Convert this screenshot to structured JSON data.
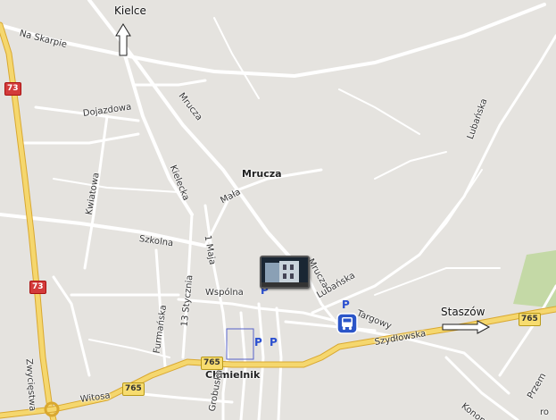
{
  "map": {
    "destinations": {
      "north": "Kielce",
      "east": "Staszów"
    },
    "town": "Chmielnik",
    "place": "Mrucza",
    "streets": {
      "na_skarpie": "Na Skarpie",
      "mrucza": "Mrucza",
      "dojazdowa": "Dojazdowa",
      "kielecka": "Kielecka",
      "kwiatowa": "Kwiatowa",
      "mala": "Mała",
      "szkolna": "Szkolna",
      "jedenego_maja": "1 Maja",
      "trzynastego_stycznia": "13 Stycznia",
      "furmanska": "Furmańska",
      "wspolna": "Wspólna",
      "mrucza_south": "Mrucza",
      "lubanska_east": "Lubańska",
      "lubanska": "Lubańska",
      "targowy": "Targowy",
      "szydlowska": "Szydłowska",
      "witosa": "Witosa",
      "zwyciestwa": "Zwycięstwa",
      "grobuska": "Grobuska",
      "konopnicka": "Konopni",
      "przem": "Przem",
      "corner": "ro"
    },
    "road_shields": {
      "r73_top": "73",
      "r73_bottom": "73",
      "r765_east": "765",
      "r765_center": "765",
      "r765_west": "765"
    },
    "parking": {
      "p1": "P",
      "p2": "P",
      "p3": "P",
      "p4": "P"
    },
    "colors": {
      "background": "#e5e3df",
      "road": "#ffffff",
      "highway": "#f5d76e",
      "shield_red": "#d33b3b",
      "park_green": "#c4d9a6",
      "parking_blue": "#2a4fd0"
    },
    "icons": [
      "arrow-up-icon",
      "arrow-right-icon",
      "photo-marker-icon",
      "bus-stop-icon"
    ]
  }
}
